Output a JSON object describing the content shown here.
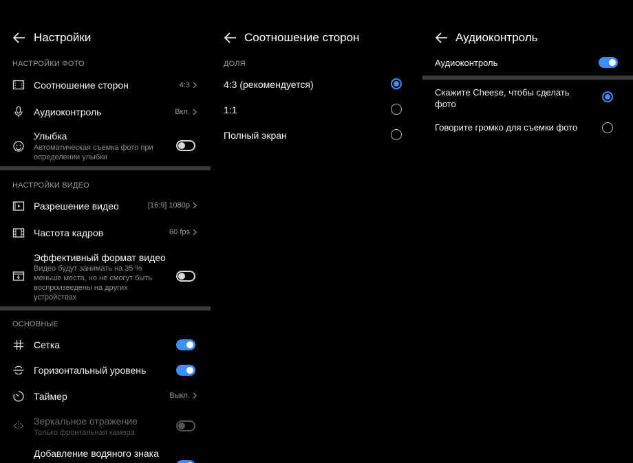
{
  "settings": {
    "title": "Настройки",
    "photo_section": "НАСТРОЙКИ ФОТО",
    "aspect_ratio": {
      "label": "Соотношение сторон",
      "value": "4:3"
    },
    "audio_control": {
      "label": "Аудиоконтроль",
      "value": "Вкл."
    },
    "smile": {
      "label": "Улыбка",
      "sub": "Автоматическая съемка фото при определении улыбки",
      "on": false
    },
    "video_section": "НАСТРОЙКИ ВИДЕО",
    "video_resolution": {
      "label": "Разрешение видео",
      "value": "[16:9] 1080p"
    },
    "frame_rate": {
      "label": "Частота кадров",
      "value": "60 fps"
    },
    "efficient_format": {
      "label": "Эффективный формат видео",
      "sub": "Видео будут занимать на 35 % меньше места, но не смогут быть воспроизведены на других устройствах",
      "on": false
    },
    "basic_section": "ОСНОВНЫЕ",
    "grid": {
      "label": "Сетка",
      "on": true
    },
    "level": {
      "label": "Горизонтальный уровень",
      "on": true
    },
    "timer": {
      "label": "Таймер",
      "value": "Выкл."
    },
    "mirror": {
      "label": "Зеркальное отражение",
      "sub": "Только фронтальная камера",
      "on": false,
      "disabled": true
    },
    "watermark": {
      "label": "Добавление водяного знака",
      "on": true
    }
  },
  "aspect": {
    "title": "Соотношение сторон",
    "section": "ДОЛЯ",
    "options": [
      {
        "label": "4:3 (рекомендуется)",
        "selected": true
      },
      {
        "label": "1:1",
        "selected": false
      },
      {
        "label": "Полный экран",
        "selected": false
      }
    ]
  },
  "audio": {
    "title": "Аудиоконтроль",
    "toggle_label": "Аудиоконтроль",
    "toggle_on": true,
    "options": [
      {
        "label": "Скажите Cheese, чтобы сделать фото",
        "selected": true
      },
      {
        "label": "Говорите громко для съемки фото",
        "selected": false
      }
    ]
  },
  "colors": {
    "accent": "#3f8ef7",
    "divider": "#3a3a3a",
    "background": "#000000"
  }
}
